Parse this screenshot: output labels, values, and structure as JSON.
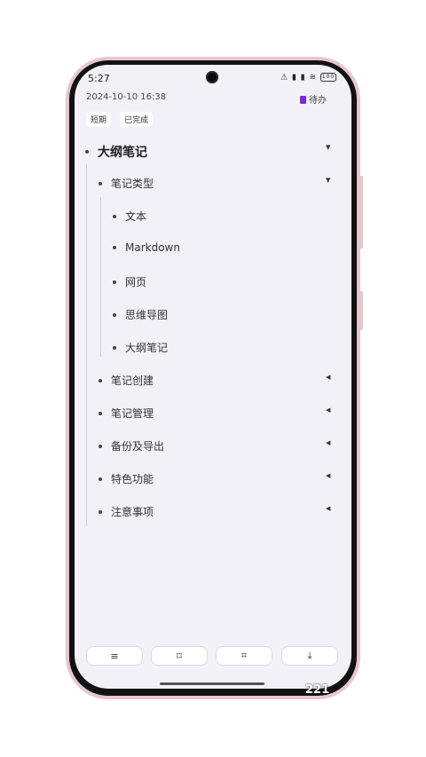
{
  "status_bar": {
    "time": "5:27",
    "icons": "⚠ ▮ ▮ ≋",
    "battery": "100"
  },
  "header": {
    "datetime": "2024-10-10 16:38",
    "todo_label": "待办",
    "todo_color": "#7b2bd6"
  },
  "tags": [
    "短期",
    "已完成"
  ],
  "outline": {
    "root": "大纲笔记",
    "sections": [
      {
        "label": "笔记类型",
        "expanded": true,
        "children": [
          "文本",
          "Markdown",
          "网页",
          "思维导图",
          "大纲笔记"
        ]
      },
      {
        "label": "笔记创建",
        "expanded": false
      },
      {
        "label": "笔记管理",
        "expanded": false
      },
      {
        "label": "备份及导出",
        "expanded": false
      },
      {
        "label": "特色功能",
        "expanded": false
      },
      {
        "label": "注意事项",
        "expanded": false
      }
    ]
  },
  "toolbar": [
    {
      "icon": "list-icon",
      "glyph": "≡"
    },
    {
      "icon": "bookmark-icon",
      "glyph": "⌑"
    },
    {
      "icon": "crop-icon",
      "glyph": "⌗"
    },
    {
      "icon": "download-icon",
      "glyph": "⤓"
    }
  ],
  "watermark": "221"
}
